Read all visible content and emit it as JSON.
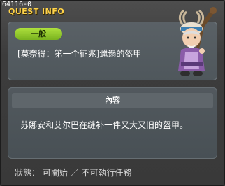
{
  "window": {
    "id": "64116-0",
    "title": "QUEST INFO"
  },
  "quest": {
    "category_badge": "一般",
    "name": "[莫奈得：第一个征兆]邋遢的盔甲",
    "npc_icon": "elderly-npc-portrait"
  },
  "content": {
    "header": "內容",
    "description": "苏娜安和艾尔巴在缝补一件又大又旧的盔甲。"
  },
  "status": {
    "text": "狀態： 可開始 ／ 不可執行任務"
  },
  "colors": {
    "title_accent": "#ffd34a",
    "badge_green": "#8cc62a"
  }
}
